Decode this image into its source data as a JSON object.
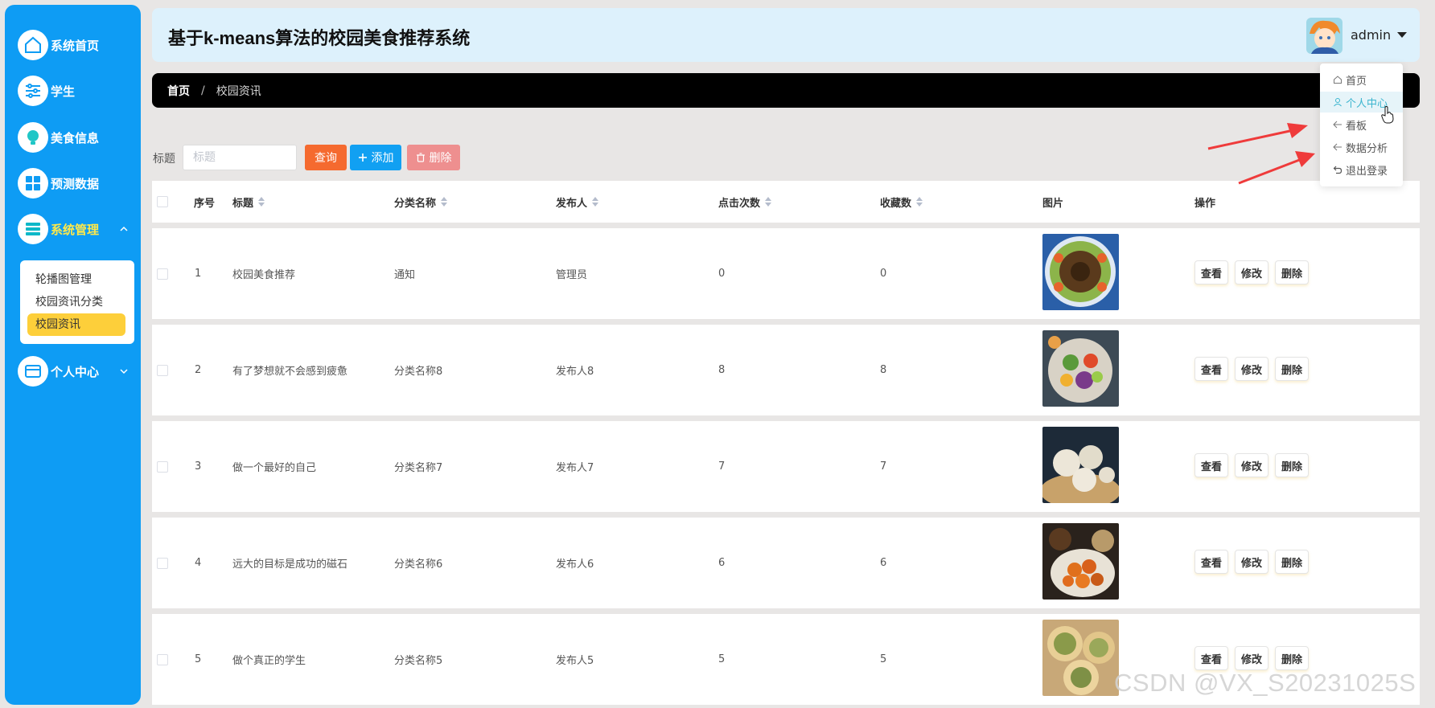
{
  "app": {
    "title": "基于k-means算法的校园美食推荐系统"
  },
  "sidebar": {
    "items": [
      {
        "label": "系统首页",
        "icon": "home-icon"
      },
      {
        "label": "学生",
        "icon": "sliders-icon"
      },
      {
        "label": "美食信息",
        "icon": "bulb-icon"
      },
      {
        "label": "预测数据",
        "icon": "grid-icon"
      },
      {
        "label": "系统管理",
        "icon": "list-icon",
        "active": true
      },
      {
        "label": "个人中心",
        "icon": "card-icon"
      }
    ],
    "submenu": [
      {
        "label": "轮播图管理"
      },
      {
        "label": "校园资讯分类"
      },
      {
        "label": "校园资讯",
        "active": true
      }
    ]
  },
  "header": {
    "username": "admin"
  },
  "breadcrumb": {
    "home": "首页",
    "separator": "/",
    "current": "校园资讯"
  },
  "search": {
    "label": "标题",
    "placeholder": "标题",
    "query_label": "查询",
    "add_label": "添加",
    "delete_label": "删除"
  },
  "table": {
    "columns": [
      "序号",
      "标题",
      "分类名称",
      "发布人",
      "点击次数",
      "收藏数",
      "图片",
      "操作"
    ],
    "rows": [
      {
        "index": "1",
        "title": "校园美食推荐",
        "category": "通知",
        "publisher": "管理员",
        "clicks": "0",
        "favorites": "0"
      },
      {
        "index": "2",
        "title": "有了梦想就不会感到疲惫",
        "category": "分类名称8",
        "publisher": "发布人8",
        "clicks": "8",
        "favorites": "8"
      },
      {
        "index": "3",
        "title": "做一个最好的自己",
        "category": "分类名称7",
        "publisher": "发布人7",
        "clicks": "7",
        "favorites": "7"
      },
      {
        "index": "4",
        "title": "远大的目标是成功的磁石",
        "category": "分类名称6",
        "publisher": "发布人6",
        "clicks": "6",
        "favorites": "6"
      },
      {
        "index": "5",
        "title": "做个真正的学生",
        "category": "分类名称5",
        "publisher": "发布人5",
        "clicks": "5",
        "favorites": "5"
      }
    ],
    "actions": {
      "view": "查看",
      "edit": "修改",
      "delete": "删除"
    }
  },
  "dropdown": {
    "items": [
      {
        "label": "首页",
        "icon": "home-icon"
      },
      {
        "label": "个人中心",
        "icon": "user-icon",
        "hovered": true
      },
      {
        "label": "看板",
        "icon": "arrow-left-icon"
      },
      {
        "label": "数据分析",
        "icon": "arrow-left-icon"
      },
      {
        "label": "退出登录",
        "icon": "logout-icon"
      }
    ]
  },
  "watermark": "CSDN @VX_S20231025S",
  "colors": {
    "sidebar": "#0e9cf4",
    "submenu_active": "#fdcf3a",
    "query_button": "#f56a2f",
    "add_button": "#11a0f2",
    "delete_button": "#ee8f8f",
    "annotation_arrow": "#ef3b3b"
  }
}
